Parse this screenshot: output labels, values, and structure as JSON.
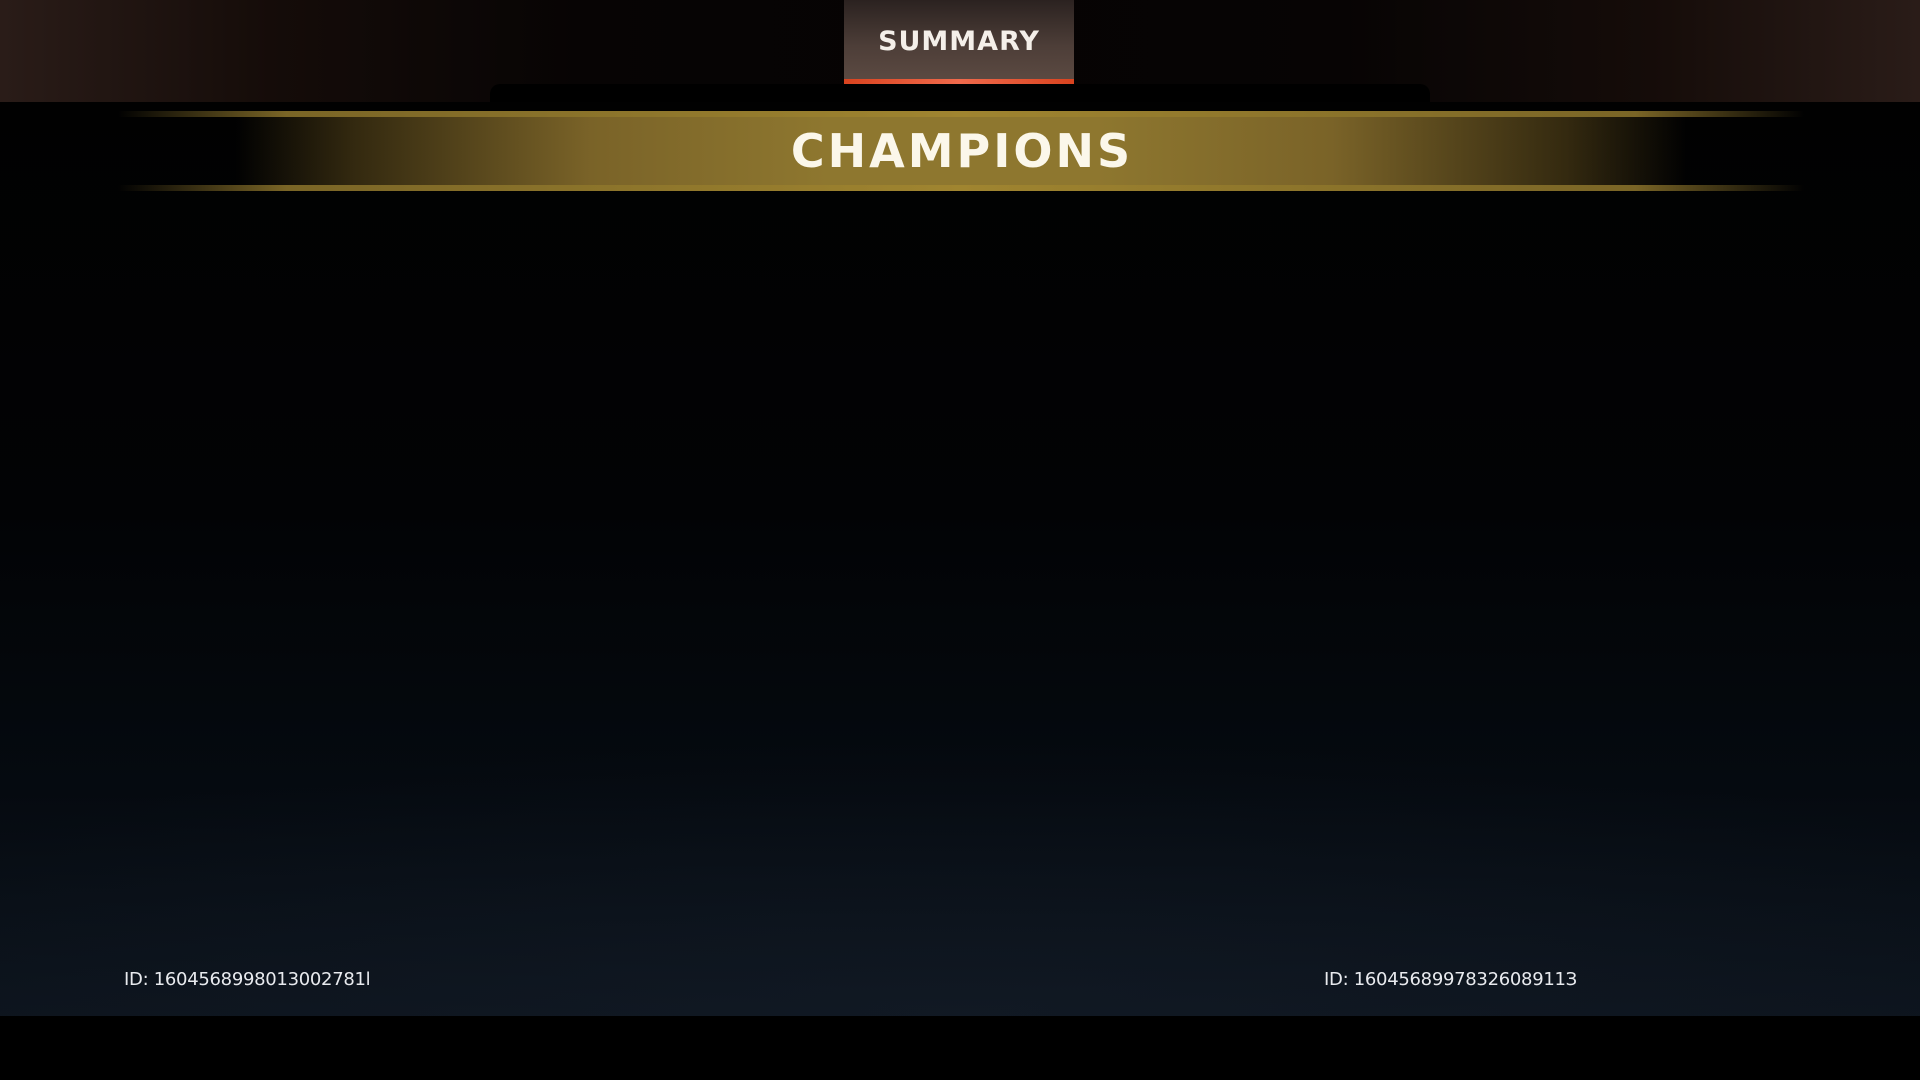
{
  "header": {
    "tab_label": "SUMMARY"
  },
  "banner": {
    "title": "CHAMPIONS"
  },
  "players": [
    {
      "id_label": "ID: 1604568998013002781l"
    },
    {
      "id_label": "ID: 1604568997832608911З"
    }
  ],
  "colors": {
    "tab_underline": "#f06a4c",
    "banner_gold": "#8e772f",
    "banner_text": "#fbf7ea"
  }
}
